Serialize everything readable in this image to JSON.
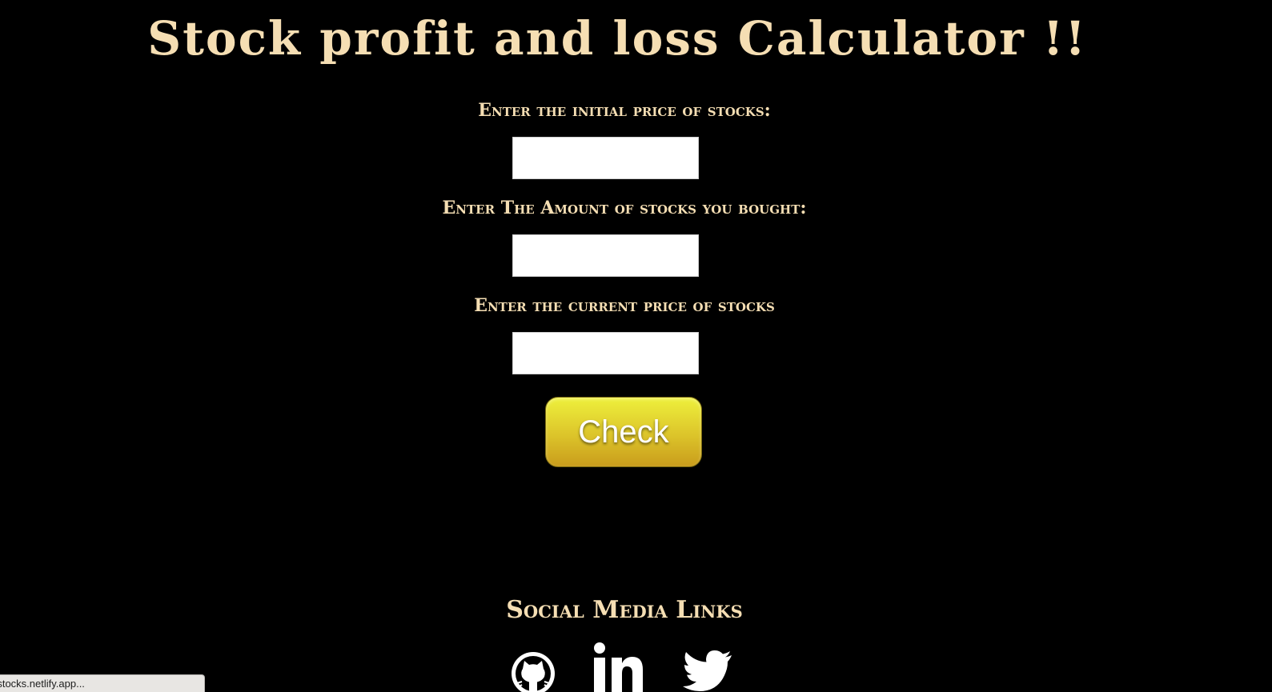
{
  "colors": {
    "background": "#000000",
    "heading": "#f5deb3",
    "button_gradient_top": "#eef03c",
    "button_gradient_bottom": "#c99c1c",
    "button_text": "#ffffff",
    "icon": "#ffffff"
  },
  "title": "Stock profit and loss Calculator !!",
  "form": {
    "fields": [
      {
        "label": "Enter the initial price of stocks:",
        "value": "",
        "placeholder": ""
      },
      {
        "label": "Enter The Amount of stocks you bought:",
        "value": "",
        "placeholder": ""
      },
      {
        "label": "Enter the current price of stocks",
        "value": "",
        "placeholder": ""
      }
    ],
    "check_label": "Check"
  },
  "social": {
    "heading": "Social Media Links",
    "icons": [
      "github-icon",
      "linkedin-icon",
      "twitter-icon"
    ]
  },
  "status_bar": {
    "url": "-stocks.netlify.app..."
  }
}
